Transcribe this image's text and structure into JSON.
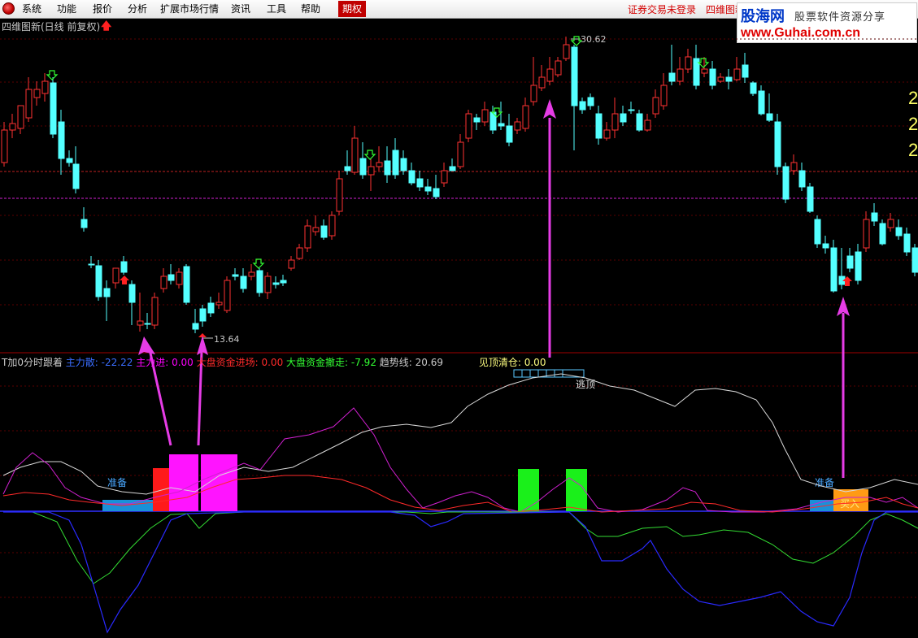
{
  "menu": {
    "items": [
      "系统",
      "功能",
      "报价",
      "分析",
      "扩展市场行情",
      "资讯",
      "工具",
      "帮助"
    ],
    "highlight": "期权",
    "status_login": "证券交易未登录",
    "status_tab": "四维图新"
  },
  "watermark": {
    "brand": "股海网",
    "slogan": "股票软件资源分享",
    "url": "www.Guhai.com.cn"
  },
  "chart": {
    "title": "四维图新(日线 前复权)",
    "high_label": "30.62",
    "low_label": "13.64",
    "right_axis_digits": [
      "2",
      "2",
      "2"
    ]
  },
  "indicator": {
    "name": "T加0分时跟着",
    "legend": [
      {
        "label": "主力散:",
        "value": "-22.22",
        "color": "#3a6dff"
      },
      {
        "label": "主力进:",
        "value": "0.00",
        "color": "#ff00ff"
      },
      {
        "label": "大盘资金进场:",
        "value": "0.00",
        "color": "#ff2a2a"
      },
      {
        "label": "大盘资金撤走:",
        "value": "-7.92",
        "color": "#33ff33"
      },
      {
        "label": "趋势线:",
        "value": "20.69",
        "color": "#c8c8c8"
      },
      {
        "label": "见顶清仓:",
        "value": "0.00",
        "color": "#ffff80"
      }
    ],
    "signals": {
      "prepare_1": "准备",
      "prepare_2": "准备",
      "buy": "买入",
      "escape_top": "逃顶"
    }
  },
  "colors": {
    "up": "#ff3232",
    "down": "#54ffff",
    "background": "#000000",
    "arrow": "#e63ce6"
  }
}
